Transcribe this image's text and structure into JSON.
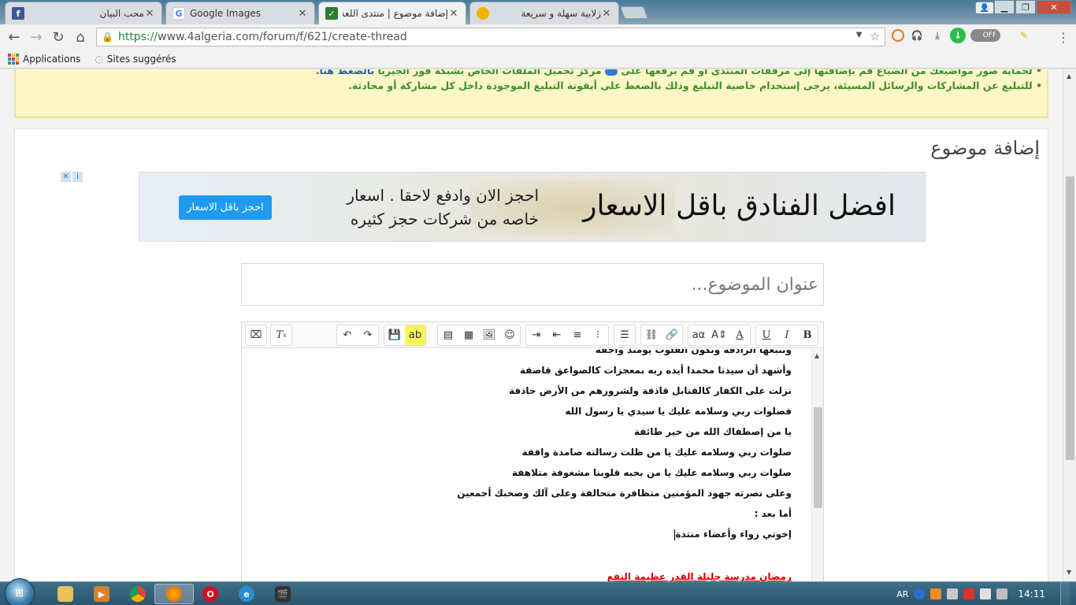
{
  "browser": {
    "tabs": [
      {
        "title": "محب البيان",
        "favicon": "facebook-icon",
        "color": "#3b5998"
      },
      {
        "title": "Google Images",
        "favicon": "google-icon",
        "color": "#4285f4"
      },
      {
        "title": "إضافة موضوع | منتدى اللغة الجز",
        "favicon": "forum-icon",
        "color": "#2e7d32",
        "active": true
      },
      {
        "title": "زلابية سهلة و سريعة",
        "favicon": "recipe-icon",
        "color": "#f0b400"
      }
    ],
    "url_https": "https://",
    "url_rest": "www.4algeria.com/forum/f/621/create-thread",
    "toggle_label": "OFF",
    "bookmarks": {
      "apps": "Applications",
      "suggested": "Sites suggérés"
    }
  },
  "notice": {
    "line1_prefix": "• لحماية صور مواضيعك من الضياع قم بإضافتها إلى مرفقات المنتدى أو قم برفعها على",
    "line1_middle": "مركز تحميل الملفات الخاص بشبكة فور الجيريا",
    "line1_link": "بالضغط هنا.",
    "line2": "• للتبليغ عن المشاركات والرسائل المسيئة، يرجى إستخدام خاصية التبليغ وذلك بالضغط على أيقونة التبليغ الموجودة داخل كل مشاركة أو محادثة."
  },
  "page": {
    "title": "إضافة موضوع",
    "title_placeholder": "عنوان الموضوع..."
  },
  "ad": {
    "close_x": "✕",
    "info_i": "i",
    "button": "احجز باقل الاسعار",
    "mid_line1": "احجز الان وادفع لاحقا . اسعار",
    "mid_line2": "خاصه من شركات حجز كثيره",
    "headline": "افضل الفنادق باقل الاسعار"
  },
  "editor": {
    "lines": [
      {
        "text": "وتتبعها الرادفة وتكون القلوب يومئذ واجفة",
        "red": false
      },
      {
        "text": "وأشهد أن سيدنا محمدا أيده ربه بمعجزات كالصواعق قاصفة",
        "red": false
      },
      {
        "text": "نزلت على الكفار كالقنابل قاذفة ولشرورهم من الأرض حاذفة",
        "red": false
      },
      {
        "text": "فصلوات ربي وسلامه عليك يا سيدي يا رسول الله",
        "red": false
      },
      {
        "text": "يا من إصطفاك الله من خير طائفة",
        "red": false
      },
      {
        "text": "صلوات ربي وسلامه عليك يا من ظلت رسالته صامدة واقفة",
        "red": false
      },
      {
        "text": "صلوات ربي وسلامه عليك يا من بحبه قلوبنا مشغوفة متلاهفة",
        "red": false
      },
      {
        "text": "وعلى نصرته جهود المؤمنين متظافرة متحالفة وعلى آلك وصحبك أجمعين",
        "red": false
      },
      {
        "text": "أما بعد :",
        "red": false
      },
      {
        "text": "إخوتي زواء وأعضاء منتدة",
        "red": false,
        "caret": true
      },
      {
        "text": "رمضان مدرسة جليلة القدر عظيمة النفع",
        "red": true
      }
    ]
  },
  "taskbar": {
    "lang": "AR",
    "time": "14:11"
  }
}
